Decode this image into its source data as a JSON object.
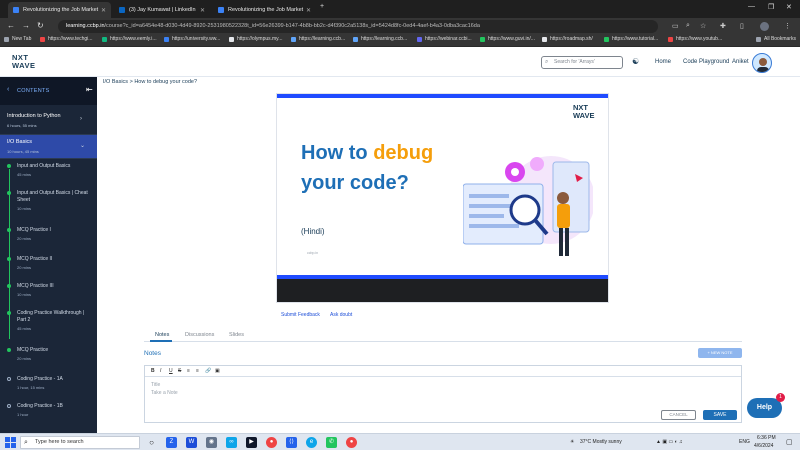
{
  "browser": {
    "tabs": [
      {
        "label": "Revolutionizing the Job Market",
        "fav": "#3b82f6"
      },
      {
        "label": "(3) Jay Kumawat | LinkedIn",
        "fav": "#0a66c2"
      },
      {
        "label": "Revolutionizing the Job Market",
        "fav": "#3b82f6"
      }
    ],
    "url_host": "learning.ccbp.in",
    "url_rest": "/course?c_id=a6454e48-d030-4d49-8920-2531980522328t_id=56e26399-b147-4b8b-bb2c-d4f390c2a5138s_id=5424d8fc-0ed4-4aef-b4a3-0dba3cac16da",
    "bookmarks": [
      "New Tab",
      "https://www.techgi...",
      "https://www.eemly.i...",
      "https://university.ww...",
      "https://olympus.my...",
      "https://learning.ccb...",
      "https://learning.ccb...",
      "https://webinar.ccbi...",
      "https://www.guvi.in/...",
      "https://roadmap.sh/",
      "https://www.tutorial...",
      "https://www.youtub..."
    ],
    "all_bookmarks": "All Bookmarks"
  },
  "header": {
    "logo_line1": "NXT",
    "logo_line2": "WAVE",
    "search_placeholder": "Search for 'Arrays'",
    "home": "Home",
    "code_playground": "Code Playground",
    "user": "Aniket"
  },
  "sidebar": {
    "contents_label": "CONTENTS",
    "courses": [
      {
        "title": "Introduction to Python",
        "duration": "6 hours, 55 mins"
      },
      {
        "title": "I/O Basics",
        "duration": "10 hours, 45 mins"
      }
    ],
    "items": [
      {
        "title": "Input and Output Basics",
        "meta": "45 mins"
      },
      {
        "title": "Input and Output Basics | Cheat Sheet",
        "meta": "10 mins"
      },
      {
        "title": "MCQ Practice I",
        "meta": "20 mins"
      },
      {
        "title": "MCQ Practice II",
        "meta": "20 mins"
      },
      {
        "title": "MCQ Practice III",
        "meta": "10 mins"
      },
      {
        "title": "Coding Practice Walkthrough | Part 2",
        "meta": "45 mins"
      },
      {
        "title": "MCQ Practice",
        "meta": "20 mins"
      },
      {
        "title": "Coding Practice - 1A",
        "meta": "1 hour, 15 mins"
      },
      {
        "title": "Coding Practice - 1B",
        "meta": "1 hour"
      }
    ]
  },
  "main": {
    "breadcrumb": "I/O Basics > How to debug your code?",
    "video": {
      "logo_line1": "NXT",
      "logo_line2": "WAVE",
      "title_a": "How to ",
      "title_highlight": "debug",
      "title_b": "your code?",
      "language": "(Hindi)",
      "small": "ccbp.in"
    },
    "submit_feedback": "Submit Feedback",
    "ask_doubt": "Ask doubt",
    "tabs": [
      "Notes",
      "Discussions",
      "Slides"
    ],
    "notes_title": "Notes",
    "new_note": "+ NEW NOTE",
    "editor_toolbar": [
      "B",
      "I",
      "U",
      "S",
      "≡",
      "≡",
      "🔗",
      "▣"
    ],
    "editor_title_placeholder": "Title",
    "editor_body_placeholder": "Take a Note",
    "cancel": "CANCEL",
    "save": "SAVE",
    "help": "Help",
    "help_badge": "1"
  },
  "taskbar": {
    "search_placeholder": "Type here to search",
    "weather": "37°C  Mostly sunny",
    "lang": "ENG",
    "time": "6:36 PM",
    "date": "4/6/2024"
  },
  "colors": {
    "brand_blue": "#1e6fb6",
    "sidebar_bg": "#1b2638",
    "accent_orange": "#f59e0b",
    "complete_green": "#22c55e"
  }
}
